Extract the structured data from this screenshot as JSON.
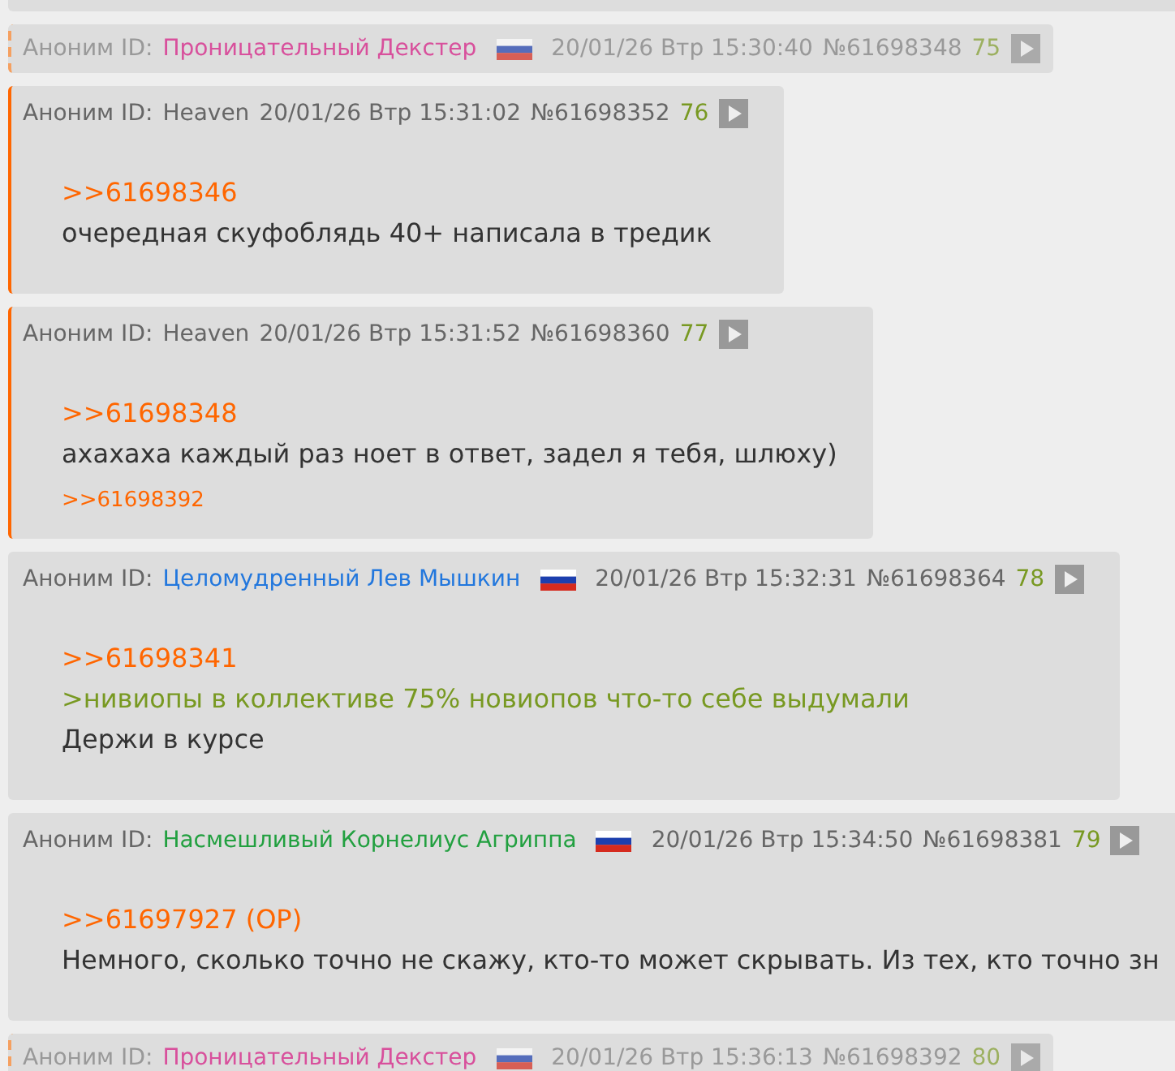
{
  "posts": [
    {
      "kind": "partial"
    },
    {
      "kind": "collapsed",
      "highlighted": true,
      "poster": "Аноним ID:",
      "id": "Проницательный Декстер",
      "color": "#d8509c",
      "flag": true,
      "date": "20/01/26 Втр 15:30:40",
      "number": "№61698348",
      "counter": "75"
    },
    {
      "kind": "post",
      "highlighted": true,
      "poster": "Аноним ID:",
      "id": "Heaven",
      "color": "#666666",
      "flag": false,
      "date": "20/01/26 Втр 15:31:02",
      "number": "№61698352",
      "counter": "76",
      "lines": [
        {
          "kind": "reply",
          "text": ">>61698346"
        },
        {
          "kind": "text",
          "text": "очередная скуфоблядь 40+ написала в тредик"
        }
      ]
    },
    {
      "kind": "post",
      "highlighted": true,
      "poster": "Аноним ID:",
      "id": "Heaven",
      "color": "#666666",
      "flag": false,
      "date": "20/01/26 Втр 15:31:52",
      "number": "№61698360",
      "counter": "77",
      "lines": [
        {
          "kind": "reply",
          "text": ">>61698348"
        },
        {
          "kind": "text",
          "text": "ахахаха каждый раз ноет в ответ, задел я тебя, шлюху)"
        }
      ],
      "backlinks": [
        ">>61698392"
      ]
    },
    {
      "kind": "post",
      "highlighted": false,
      "poster": "Аноним ID:",
      "id": "Целомудренный Лев Мышкин",
      "color": "#2277dd",
      "flag": true,
      "date": "20/01/26 Втр 15:32:31",
      "number": "№61698364",
      "counter": "78",
      "lines": [
        {
          "kind": "reply",
          "text": ">>61698341"
        },
        {
          "kind": "quote",
          "text": ">нивиопы в коллективе 75% новиопов что-то себе выдумали"
        },
        {
          "kind": "text",
          "text": "Держи в курсе"
        }
      ]
    },
    {
      "kind": "post",
      "highlighted": false,
      "poster": "Аноним ID:",
      "id": "Насмешливый Корнелиус Агриппа",
      "color": "#22a040",
      "flag": true,
      "date": "20/01/26 Втр 15:34:50",
      "number": "№61698381",
      "counter": "79",
      "lines": [
        {
          "kind": "reply",
          "text": ">>61697927 (OP)"
        },
        {
          "kind": "text",
          "text": "Немного, сколько точно не скажу, кто-то может скрывать. Из тех, кто точно зн"
        }
      ]
    },
    {
      "kind": "collapsed",
      "highlighted": true,
      "poster": "Аноним ID:",
      "id": "Проницательный Декстер",
      "color": "#d8509c",
      "flag": true,
      "date": "20/01/26 Втр 15:36:13",
      "number": "№61698392",
      "counter": "80"
    }
  ]
}
